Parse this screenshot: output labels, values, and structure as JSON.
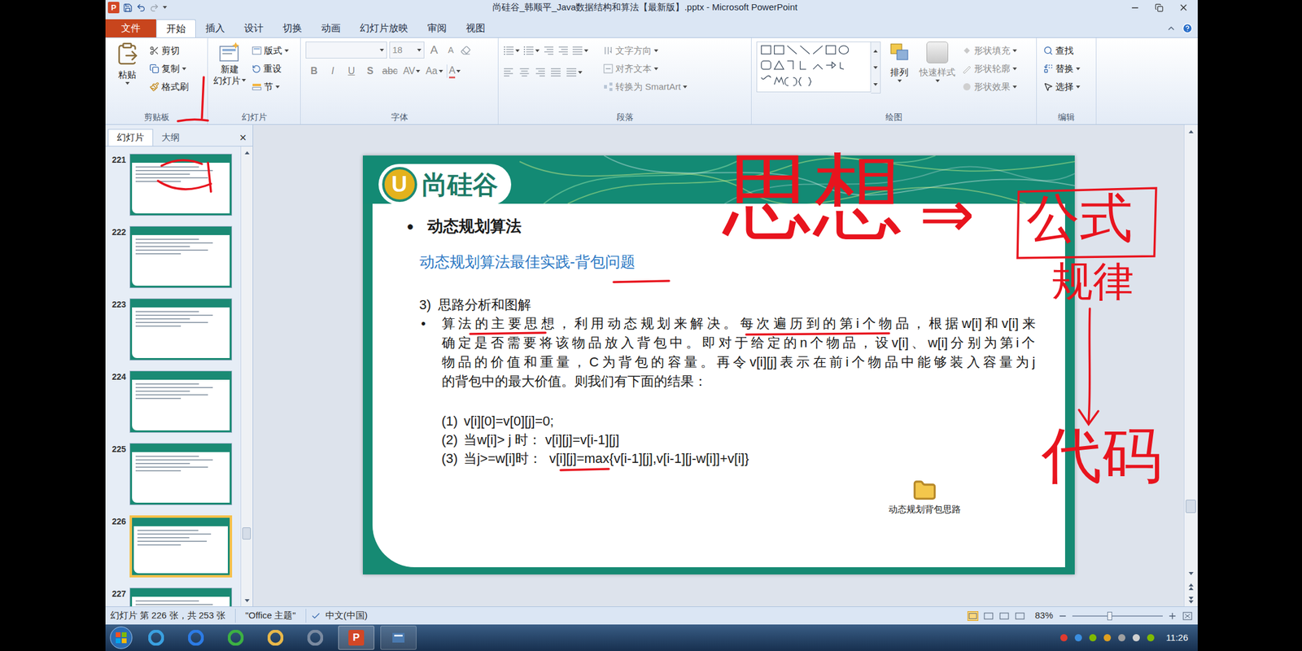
{
  "window": {
    "app_icon": "P",
    "title": "尚硅谷_韩顺平_Java数据结构和算法【最新版】.pptx - Microsoft PowerPoint"
  },
  "ribbon_tabs": [
    {
      "label": "文件",
      "selected": false,
      "kind": "file"
    },
    {
      "label": "开始",
      "selected": true,
      "kind": "tab"
    },
    {
      "label": "插入",
      "selected": false,
      "kind": "tab"
    },
    {
      "label": "设计",
      "selected": false,
      "kind": "tab"
    },
    {
      "label": "切换",
      "selected": false,
      "kind": "tab"
    },
    {
      "label": "动画",
      "selected": false,
      "kind": "tab"
    },
    {
      "label": "幻灯片放映",
      "selected": false,
      "kind": "tab"
    },
    {
      "label": "审阅",
      "selected": false,
      "kind": "tab"
    },
    {
      "label": "视图",
      "selected": false,
      "kind": "tab"
    }
  ],
  "clipboard": {
    "label": "剪贴板",
    "paste": "粘贴",
    "cut": "剪切",
    "copy": "复制",
    "format_painter": "格式刷"
  },
  "slides_group": {
    "label": "幻灯片",
    "new_slide": [
      "新建",
      "幻灯片"
    ],
    "layout": "版式",
    "reset": "重设",
    "section": "节"
  },
  "font": {
    "label": "字体",
    "disabled": true,
    "font_name": "",
    "font_size": "18",
    "grow": "A",
    "shrink": "A",
    "buttons": [
      {
        "text": "B",
        "kind": "bold"
      },
      {
        "text": "I",
        "kind": "italic"
      },
      {
        "text": "U",
        "kind": "underline"
      },
      {
        "text": "S",
        "kind": "shadow"
      },
      {
        "text": "abc",
        "kind": "strike"
      },
      {
        "text": "AV",
        "kind": "spacing"
      },
      {
        "text": "Aa",
        "kind": "case"
      }
    ],
    "font_color": "A"
  },
  "paragraph": {
    "label": "段落",
    "disabled": true,
    "text_direction": "文字方向",
    "align_text": "对齐文本",
    "smartart": "转换为 SmartArt"
  },
  "drawing": {
    "label": "绘图",
    "arrange": "排列",
    "quick_styles": "快速样式",
    "fill": "形状填充",
    "outline": "形状轮廓",
    "effects": "形状效果",
    "styles_disabled": true
  },
  "editing": {
    "label": "编辑",
    "find": "查找",
    "replace": "替换",
    "select": "选择"
  },
  "slide_pane": {
    "tabs": [
      {
        "label": "幻灯片",
        "selected": true
      },
      {
        "label": "大纲",
        "selected": false
      }
    ],
    "close": "×",
    "scroll_position": 0.86,
    "thumbnails": [
      {
        "number": "221",
        "selected": false
      },
      {
        "number": "222",
        "selected": false
      },
      {
        "number": "223",
        "selected": false
      },
      {
        "number": "224",
        "selected": false
      },
      {
        "number": "225",
        "selected": false
      },
      {
        "number": "226",
        "selected": true
      },
      {
        "number": "227",
        "selected": false
      }
    ]
  },
  "slide": {
    "logo_mark": "U",
    "logo_text": "尚硅谷",
    "heading_bullet": "●",
    "heading": "动态规划算法",
    "subtitle": "动态规划算法最佳实践-背包问题",
    "section_number": "3)",
    "section": "思路分析和图解",
    "paragraph_bullet": "•",
    "paragraph_lines": [
      "算法的主要思想，利用动态规划来解决。每次遍历到的第i个物品，根据w[i]和v[i]来",
      "确定是否需要将该物品放入背包中。即对于给定的n个物品，设v[i]、w[i]分别为第i个",
      "物品的价值和重量，C为背包的容量。再令v[i][j]表示在前i个物品中能够装入容量为j",
      "的背包中的最大价值。则我们有下面的结果："
    ],
    "formulas": [
      {
        "number": "(1)",
        "text": "v[i][0]=v[0][j]=0;"
      },
      {
        "number": "(2)",
        "text": "当w[i]> j 时： v[i][j]=v[i-1][j]"
      },
      {
        "number": "(3)",
        "text": "当j>=w[i]时：  v[i][j]=max{v[i-1][j],v[i-1][j-w[i]]+v[i]}"
      }
    ],
    "attachment": "动态规划背包思路"
  },
  "slide_area": {
    "scroll_position": 0.86
  },
  "status_bar": {
    "slide_info": "幻灯片 第 226 张，共 253 张",
    "theme": "\"Office 主题\"",
    "language": "中文(中国)",
    "zoom": "83%",
    "zoom_level": 0.41
  },
  "taskbar": {
    "time": "11:26"
  },
  "annotations": [
    "思想",
    "⇒",
    "公式",
    "规律",
    "代码"
  ]
}
